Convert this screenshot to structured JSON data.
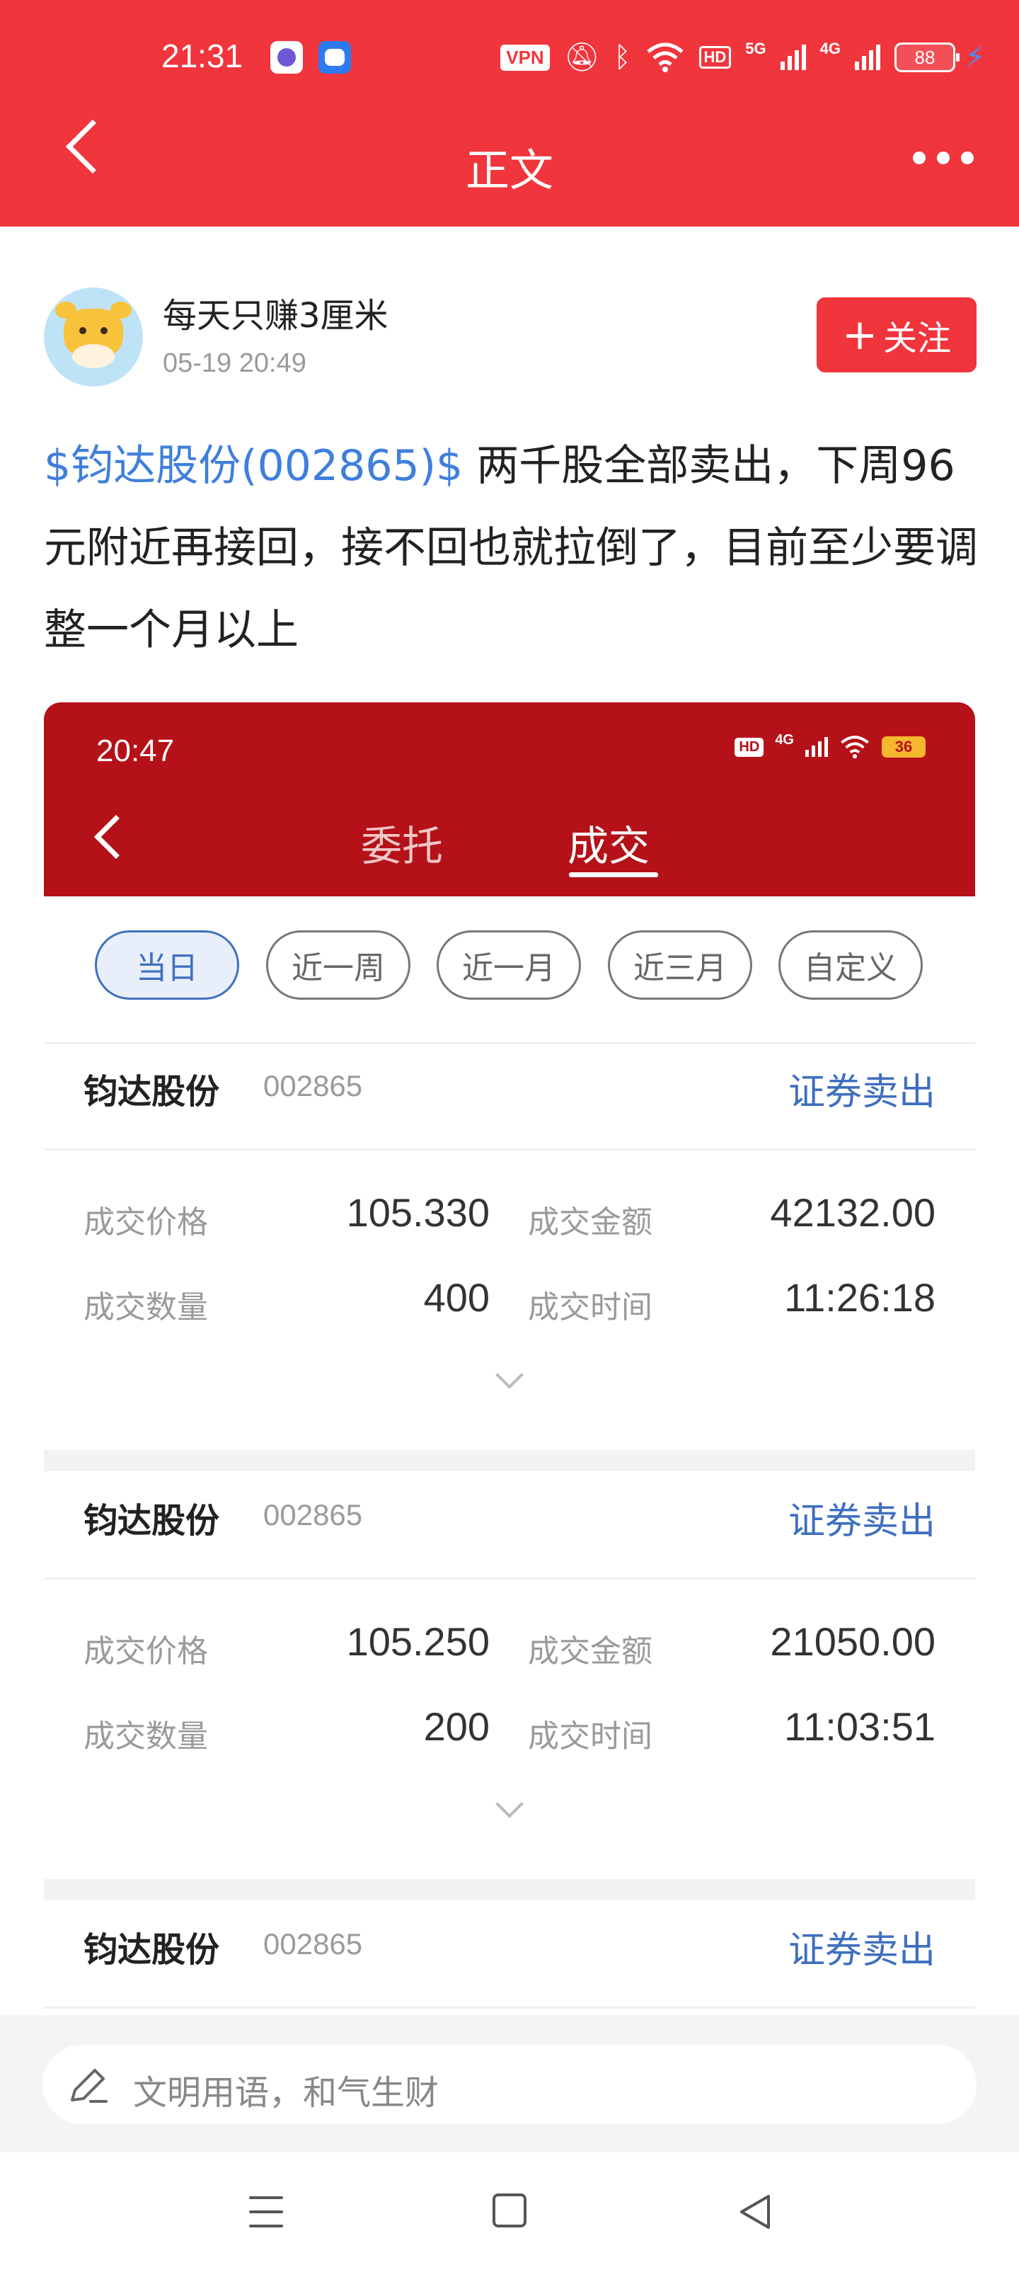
{
  "status_bar": {
    "time": "21:31",
    "vpn": "VPN",
    "hd": "HD",
    "net1": "5G",
    "net2": "4G",
    "battery": "88"
  },
  "header": {
    "title": "正文"
  },
  "post": {
    "author": "每天只赚3厘米",
    "time": "05-19 20:49",
    "follow_label": "关注",
    "stock_link": "$钧达股份(002865)$",
    "text": " 两千股全部卖出，下周96元附近再接回，接不回也就拉倒了，目前至少要调整一个月以上"
  },
  "screenshot": {
    "status_time": "20:47",
    "hd": "HD",
    "net": "4G",
    "battery": "36",
    "tabs": [
      "委托",
      "成交"
    ],
    "active_tab": "成交",
    "filters": [
      "当日",
      "近一周",
      "近一月",
      "近三月",
      "自定义"
    ],
    "active_filter": "当日",
    "labels": {
      "price": "成交价格",
      "amount": "成交金额",
      "qty": "成交数量",
      "time": "成交时间"
    },
    "trades": [
      {
        "name": "钧达股份",
        "code": "002865",
        "type": "证券卖出",
        "price": "105.330",
        "amount": "42132.00",
        "qty": "400",
        "time": "11:26:18"
      },
      {
        "name": "钧达股份",
        "code": "002865",
        "type": "证券卖出",
        "price": "105.250",
        "amount": "21050.00",
        "qty": "200",
        "time": "11:03:51"
      },
      {
        "name": "钧达股份",
        "code": "002865",
        "type": "证券卖出"
      }
    ]
  },
  "comment": {
    "placeholder": "文明用语，和气生财"
  },
  "icons": {
    "back": "chevron-left-icon",
    "more": "more-icon",
    "pencil": "pencil-icon",
    "nav": [
      "menu-icon",
      "home-icon",
      "back-icon"
    ]
  },
  "colors": {
    "brand_red": "#f0353d",
    "broker_red": "#b51118",
    "link_blue": "#3f7fdc",
    "accent_blue": "#3f6fbf"
  }
}
